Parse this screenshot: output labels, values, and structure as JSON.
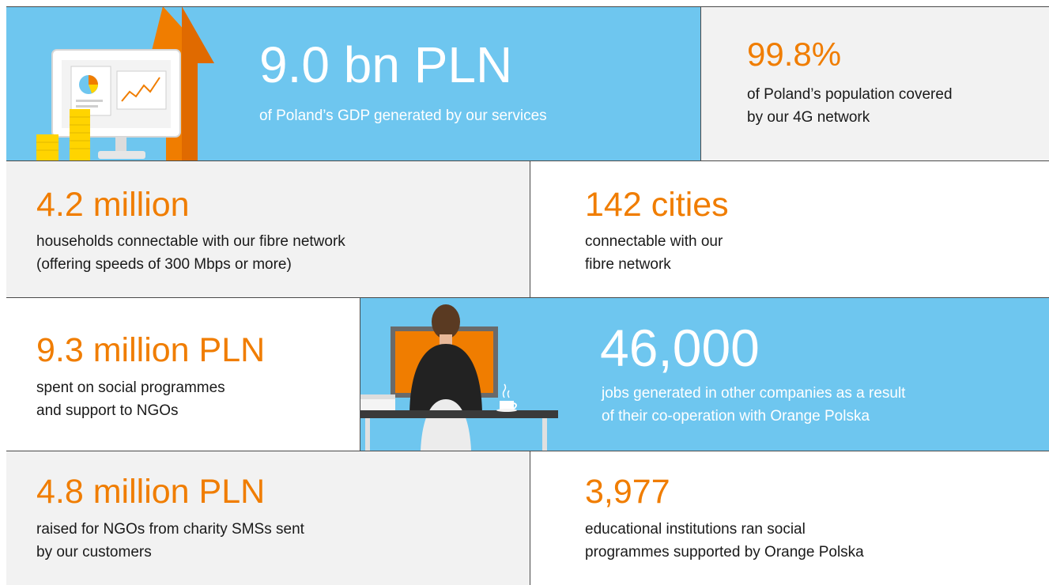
{
  "stats": {
    "gdp": {
      "value": "9.0 bn PLN",
      "lines": [
        "of Poland’s GDP generated by our services"
      ]
    },
    "coverage": {
      "value": "99.8%",
      "lines": [
        "of Poland’s population covered",
        "by our 4G network"
      ]
    },
    "households": {
      "value": "4.2 million",
      "lines": [
        "households connectable with our fibre network",
        "(offering speeds of 300 Mbps or more)"
      ]
    },
    "cities": {
      "value": "142 cities",
      "lines": [
        "connectable with our",
        "fibre network"
      ]
    },
    "social": {
      "value": "9.3 million PLN",
      "lines": [
        "spent on social programmes",
        "and support to NGOs"
      ]
    },
    "jobs": {
      "value": "46,000",
      "lines": [
        "jobs generated in other companies as a result",
        "of their co-operation with Orange Polska"
      ]
    },
    "charity": {
      "value": "4.8 million PLN",
      "lines": [
        "raised for NGOs from charity SMSs sent",
        "by our customers"
      ]
    },
    "schools": {
      "value": "3,977",
      "lines": [
        "educational institutions ran social",
        "programmes supported by Orange Polska"
      ]
    }
  },
  "colors": {
    "accent": "#f07d00",
    "tile_blue": "#6ec6ef",
    "tile_gray": "#f2f2f2"
  },
  "illustrations": {
    "top_left": "monitor-chart-coins-arrow-icon",
    "middle": "person-at-computer-icon"
  }
}
